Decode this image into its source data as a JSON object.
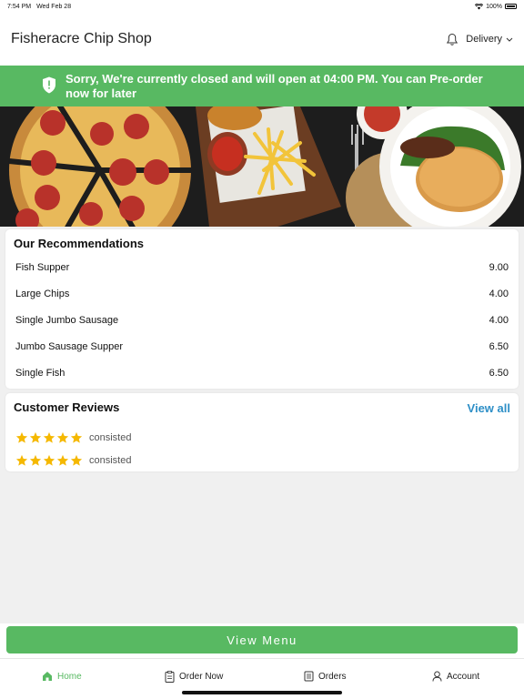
{
  "status_bar": {
    "time": "7:54 PM",
    "date": "Wed Feb 28",
    "battery": "100%"
  },
  "header": {
    "title": "Fisheracre Chip Shop",
    "bell_icon": "bell-icon",
    "mode_label": "Delivery",
    "mode_icon": "chevron-down-icon"
  },
  "banner": {
    "message": "Sorry, We're currently closed and will open at 04:00 PM. You can Pre-order now for later",
    "icon": "shield-alert-icon",
    "color": "#58b962"
  },
  "hero": {
    "description": "food-banner-image"
  },
  "recommendations": {
    "title": "Our Recommendations",
    "items": [
      {
        "name": "Fish Supper",
        "price": "9.00"
      },
      {
        "name": "Large Chips",
        "price": "4.00"
      },
      {
        "name": "Single Jumbo Sausage",
        "price": "4.00"
      },
      {
        "name": "Jumbo Sausage Supper",
        "price": "6.50"
      },
      {
        "name": "Single Fish",
        "price": "6.50"
      }
    ]
  },
  "reviews": {
    "title": "Customer Reviews",
    "view_all": "View all",
    "items": [
      {
        "rating": 5,
        "text": "consisted"
      },
      {
        "rating": 5,
        "text": "consisted"
      }
    ],
    "star_color": "#f5b800"
  },
  "view_menu": {
    "label": "View Menu"
  },
  "tabs": [
    {
      "label": "Home",
      "icon": "home-icon",
      "active": true
    },
    {
      "label": "Order Now",
      "icon": "order-icon",
      "active": false
    },
    {
      "label": "Orders",
      "icon": "receipt-icon",
      "active": false
    },
    {
      "label": "Account",
      "icon": "user-icon",
      "active": false
    }
  ],
  "colors": {
    "accent": "#58b962",
    "link": "#2e8fc7"
  }
}
